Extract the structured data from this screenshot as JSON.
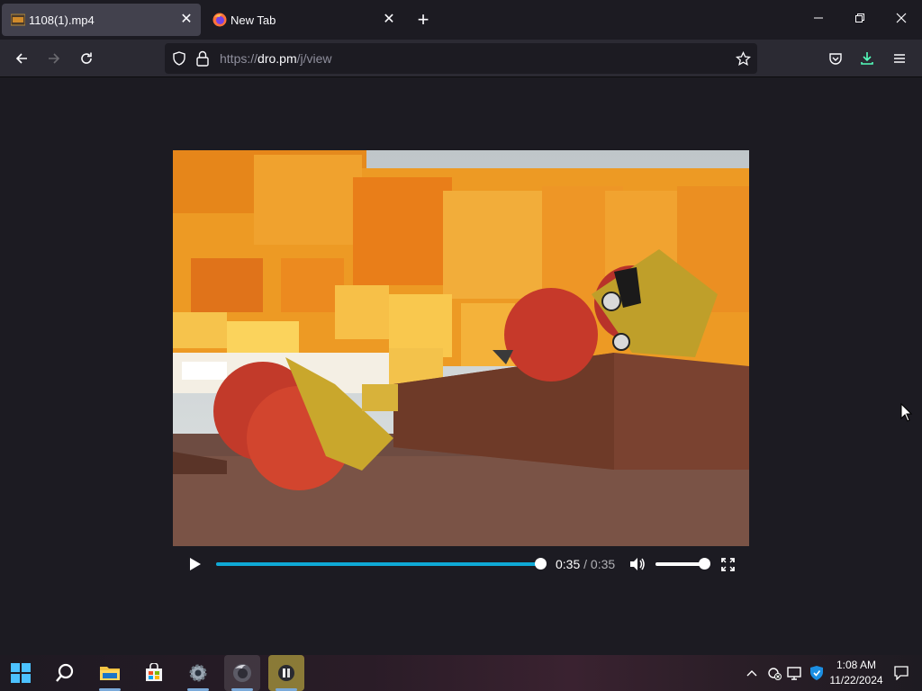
{
  "browser": {
    "tabs": [
      {
        "title": "1108(1).mp4",
        "active": true
      },
      {
        "title": "New Tab",
        "active": false
      }
    ],
    "url": {
      "prefix": "https://",
      "domain": "dro.pm",
      "path": "/j/view"
    }
  },
  "video": {
    "current_time": "0:35",
    "separator": " / ",
    "duration": "0:35",
    "progress_fraction": 1.0,
    "volume_fraction": 1.0
  },
  "taskbar": {
    "clock_time": "1:08 AM",
    "clock_date": "11/22/2024"
  },
  "colors": {
    "accent": "#0fa9d6",
    "download_icon": "#54ffbd"
  }
}
